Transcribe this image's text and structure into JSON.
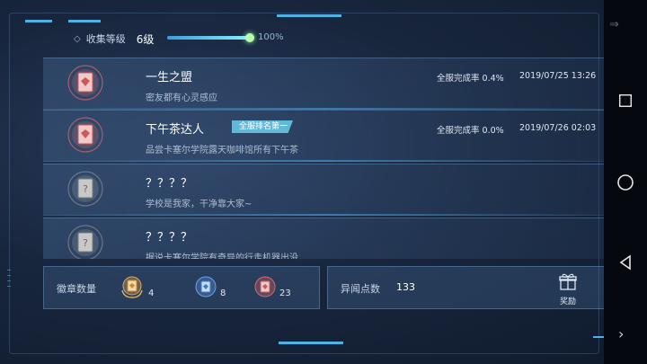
{
  "header": {
    "level_label": "收集等级",
    "level_value": "6级",
    "progress_percent_text": "100%",
    "progress_fraction": 1.0
  },
  "achievements": [
    {
      "title": "一生之盟",
      "description": "密友都有心灵感应",
      "rate": "全服完成率 0.4%",
      "date": "2019/07/25 13:26",
      "rank_tag": "",
      "locked": false
    },
    {
      "title": "下午茶达人",
      "description": "品尝卡塞尔学院露天咖啡馆所有下午茶",
      "rate": "全服完成率 0.0%",
      "date": "2019/07/26 02:03",
      "rank_tag": "全服排名第一",
      "locked": false
    },
    {
      "title": "？？？？",
      "description": "学校是我家，干净靠大家~",
      "rate": "",
      "date": "",
      "rank_tag": "",
      "locked": true
    },
    {
      "title": "？？？？",
      "description": "据说卡塞尔学院有奇异的行走机器出没",
      "rate": "",
      "date": "",
      "rank_tag": "",
      "locked": true
    }
  ],
  "badge_stats": {
    "label": "徽章数量",
    "gold_count": "4",
    "blue_count": "8",
    "red_count": "23"
  },
  "points": {
    "label": "异闻点数",
    "value": "133",
    "reward_label": "奖励"
  },
  "colors": {
    "accent": "#4bb3e6",
    "badge_red": "#e07a7a",
    "badge_gray": "#9a9a9a",
    "rank_tag": "#63b8d8"
  },
  "icons": [
    "diamond-icon",
    "achievement-badge-icon",
    "locked-badge-icon",
    "gold-medal-icon",
    "blue-medal-icon",
    "red-medal-icon",
    "gift-icon",
    "recent-apps-icon",
    "home-icon",
    "back-icon",
    "double-arrow-icon",
    "chevron-right-icon"
  ]
}
